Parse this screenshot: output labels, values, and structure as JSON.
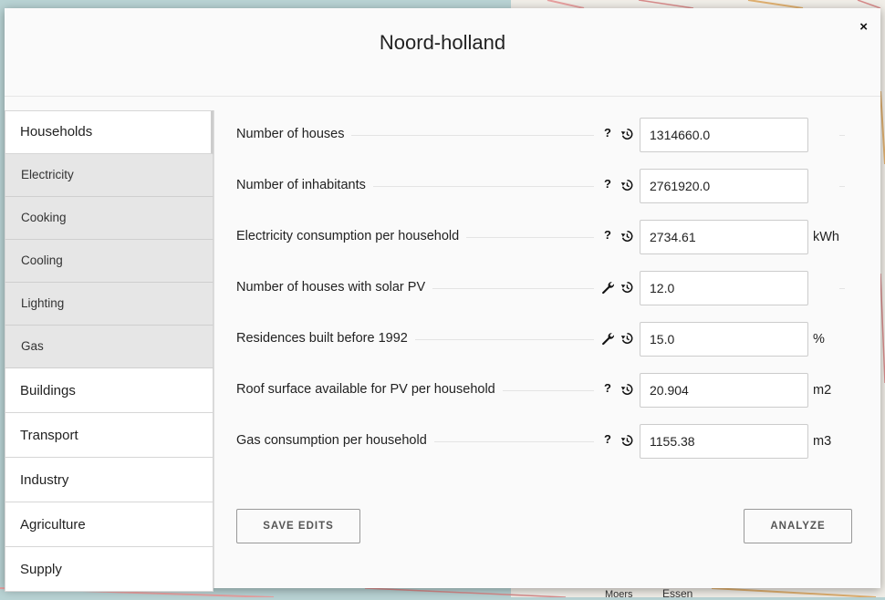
{
  "modal": {
    "title": "Noord-holland",
    "close_label": "×"
  },
  "sidebar": {
    "items": [
      {
        "label": "Households",
        "subitems": [
          "Electricity",
          "Cooking",
          "Cooling",
          "Lighting",
          "Gas"
        ]
      },
      {
        "label": "Buildings"
      },
      {
        "label": "Transport"
      },
      {
        "label": "Industry"
      },
      {
        "label": "Agriculture"
      },
      {
        "label": "Supply"
      }
    ]
  },
  "form": {
    "rows": [
      {
        "label": "Number of houses",
        "icon": "help-icon",
        "value": "1314660.0",
        "unit": ""
      },
      {
        "label": "Number of inhabitants",
        "icon": "help-icon",
        "value": "2761920.0",
        "unit": ""
      },
      {
        "label": "Electricity consumption per household",
        "icon": "help-icon",
        "value": "2734.61",
        "unit": "kWh"
      },
      {
        "label": "Number of houses with solar PV",
        "icon": "wrench-icon",
        "value": "12.0",
        "unit": ""
      },
      {
        "label": "Residences built before 1992",
        "icon": "wrench-icon",
        "value": "15.0",
        "unit": "%"
      },
      {
        "label": "Roof surface available for PV per household",
        "icon": "help-icon",
        "value": "20.904",
        "unit": "m2"
      },
      {
        "label": "Gas consumption per household",
        "icon": "help-icon",
        "value": "1155.38",
        "unit": "m3"
      }
    ]
  },
  "buttons": {
    "save_label": "SAVE EDITS",
    "analyze_label": "ANALYZE"
  },
  "map": {
    "labels": [
      "Moers",
      "Essen"
    ]
  },
  "colors": {
    "panel": "#fafafa",
    "submenu": "#e6e6e6",
    "map_water": "#b9d3d4"
  }
}
